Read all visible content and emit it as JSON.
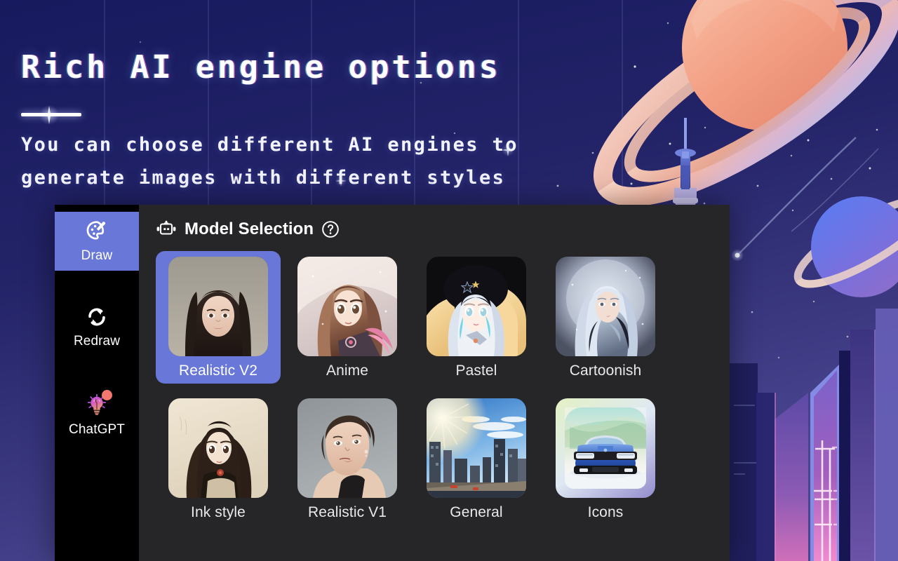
{
  "hero": {
    "title": "Rich AI engine options",
    "subtitle_line1": "You can choose different AI engines to",
    "subtitle_line2": "generate images with different styles"
  },
  "colors": {
    "background_navy": "#1c1d66",
    "accent_periwinkle": "#6877d8",
    "panel_dark": "#262628",
    "sidebar_black": "#000000",
    "badge_coral": "#f2776f",
    "planet_salmon": "#f2a68c"
  },
  "sidebar": {
    "items": [
      {
        "label": "Draw",
        "icon": "palette-icon",
        "active": true,
        "badge": false
      },
      {
        "label": "Redraw",
        "icon": "refresh-icon",
        "active": false,
        "badge": false
      },
      {
        "label": "ChatGPT",
        "icon": "lightbulb-brain-icon",
        "active": false,
        "badge": true
      }
    ]
  },
  "panel": {
    "title": "Model Selection",
    "title_icon": "robot-icon",
    "help_icon": "question-circle-icon"
  },
  "models": {
    "selected": "Realistic V2",
    "row1": [
      {
        "label": "Realistic V2",
        "selected": true
      },
      {
        "label": "Anime",
        "selected": false
      },
      {
        "label": "Pastel",
        "selected": false
      },
      {
        "label": "Cartoonish",
        "selected": false
      }
    ],
    "row2": [
      {
        "label": "Ink style",
        "selected": false
      },
      {
        "label": "Realistic V1",
        "selected": false
      },
      {
        "label": "General",
        "selected": false
      },
      {
        "label": "Icons",
        "selected": false
      }
    ]
  }
}
